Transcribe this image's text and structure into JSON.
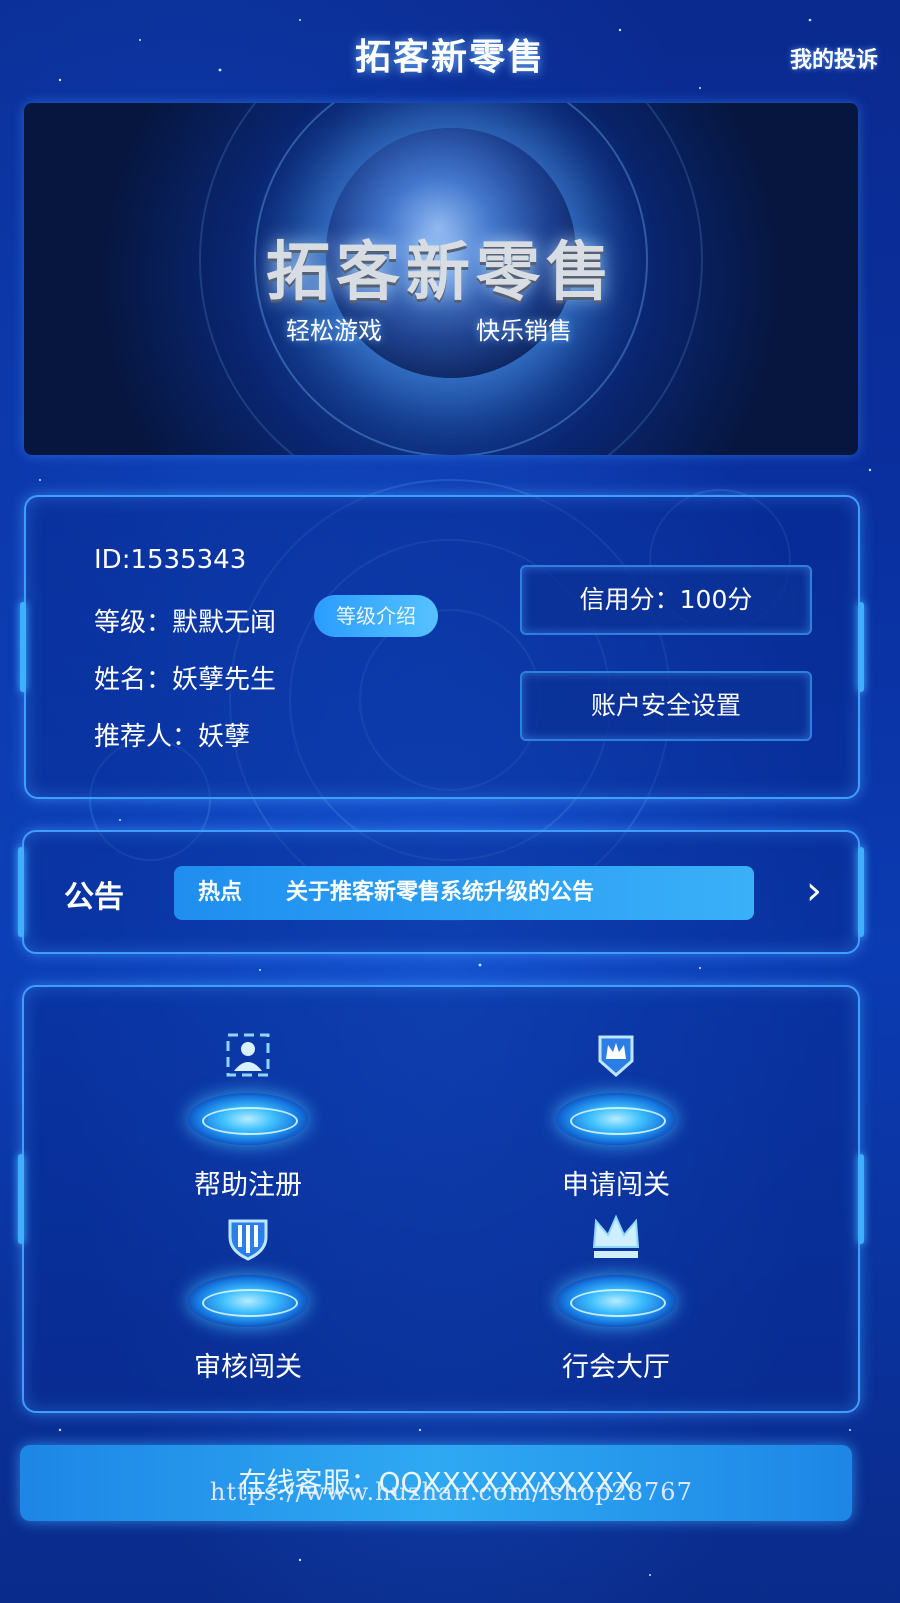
{
  "header": {
    "title": "拓客新零售",
    "complaint_label": "我的投诉"
  },
  "banner": {
    "title": "拓客新零售",
    "slogan_left": "轻松游戏",
    "slogan_right": "快乐销售"
  },
  "user": {
    "id_text": "ID:1535343",
    "level_text": "等级：默默无闻",
    "level_intro_label": "等级介绍",
    "name_text": "姓名：妖孽先生",
    "referrer_text": "推荐人：妖孽",
    "credit_label": "信用分：100分",
    "security_label": "账户安全设置"
  },
  "notice": {
    "label": "公告",
    "tag": "热点",
    "text": "关于推客新零售系统升级的公告",
    "arrow": "›"
  },
  "menu": {
    "items": [
      {
        "label": "帮助注册",
        "icon": "user-register-icon"
      },
      {
        "label": "申请闯关",
        "icon": "crown-badge-icon"
      },
      {
        "label": "审核闯关",
        "icon": "shield-icon"
      },
      {
        "label": "行会大厅",
        "icon": "crown-icon"
      }
    ]
  },
  "service": {
    "label": "在线客服：QQXXXXXXXXXXX"
  },
  "watermark": "https://www.huzhan.com/ishop28767",
  "colors": {
    "background": "#0b3bb2",
    "panel_border": "#3f9dff",
    "accent": "#2fa9f2"
  }
}
